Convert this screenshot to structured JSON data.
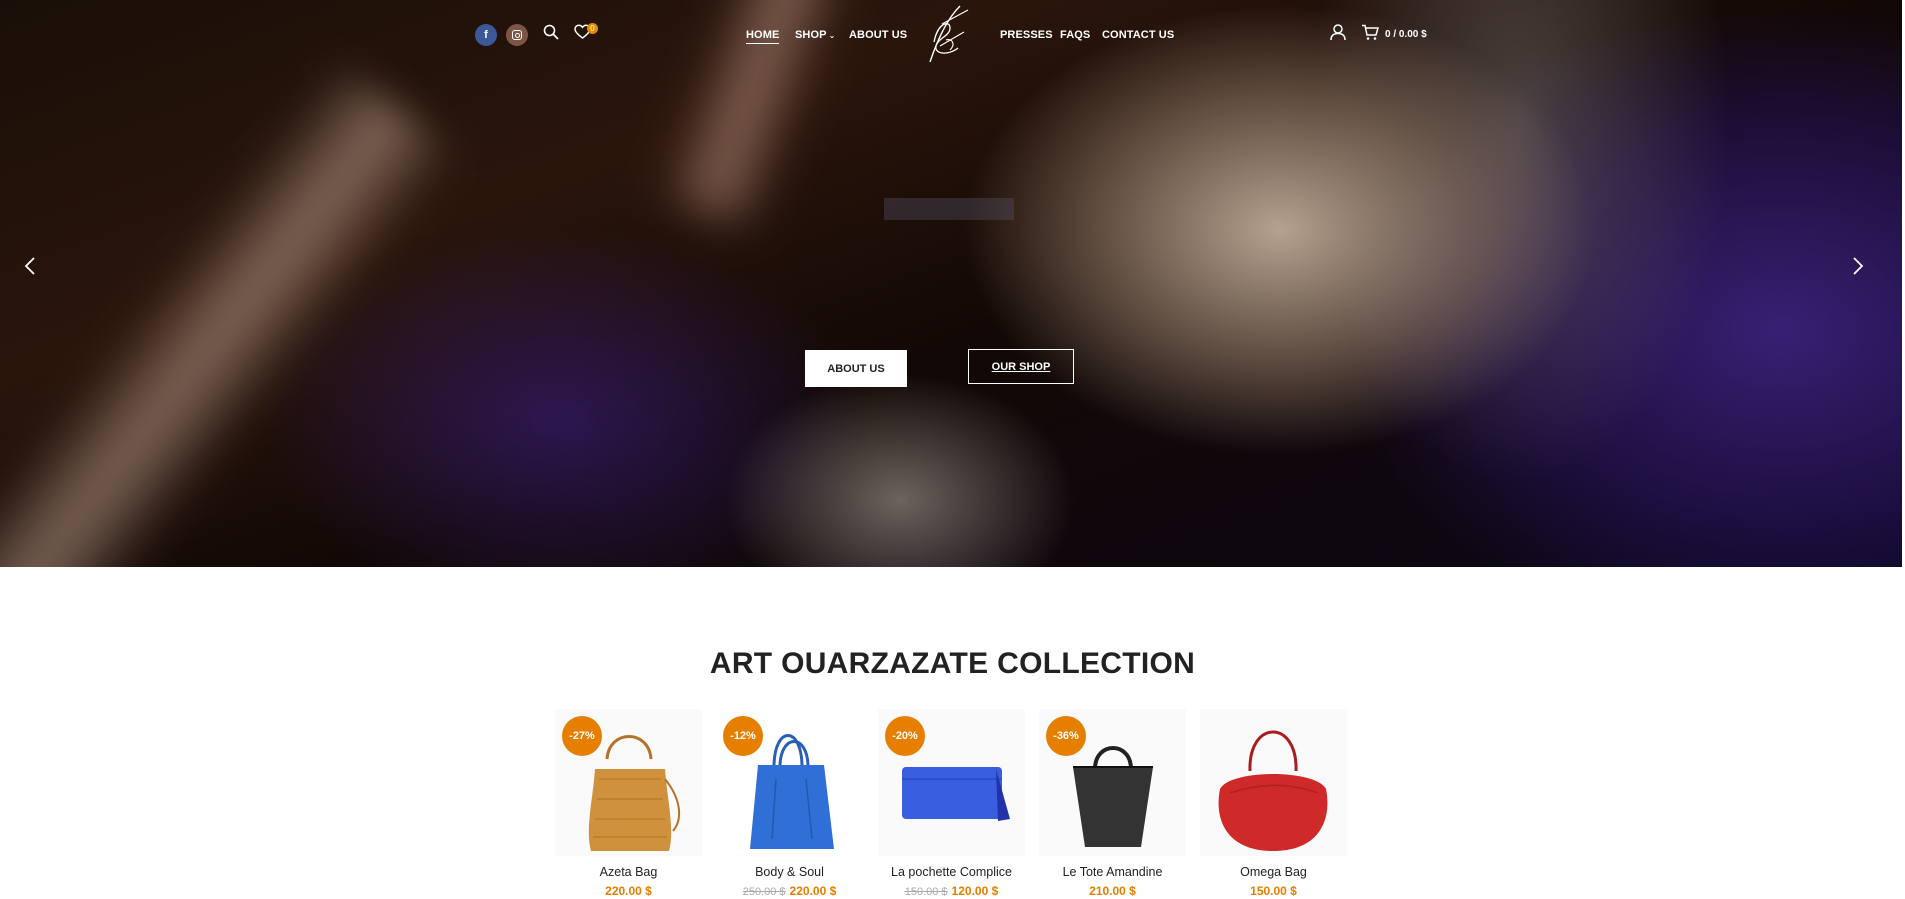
{
  "header": {
    "wishlist_count": "0",
    "nav": {
      "home": "HOME",
      "shop": "SHOP",
      "about": "ABOUT US",
      "presses": "PRESSES",
      "faqs": "FAQS",
      "contact": "CONTACT US"
    },
    "cart_total": "0 / 0.00 $",
    "icons": [
      "facebook-icon",
      "instagram-icon",
      "search-icon",
      "heart-icon",
      "user-icon",
      "cart-icon"
    ]
  },
  "hero": {
    "about_button": "ABOUT US",
    "shop_button": "OUR SHOP"
  },
  "collection": {
    "title": "ART OUARZAZATE COLLECTION",
    "products": [
      {
        "name": "Azeta Bag",
        "discount": "-27%",
        "old_price": "",
        "price": "220.00 $",
        "color": "#d0913c"
      },
      {
        "name": "Body & Soul",
        "discount": "-12%",
        "old_price": "250.00 $",
        "price": "220.00 $",
        "color": "#2f6fd6"
      },
      {
        "name": "La pochette Complice",
        "discount": "-20%",
        "old_price": "150.00 $",
        "price": "120.00 $",
        "color": "#3a5ee0"
      },
      {
        "name": "Le Tote Amandine",
        "discount": "-36%",
        "old_price": "",
        "price": "210.00 $",
        "color": "#333333"
      },
      {
        "name": "Omega Bag",
        "discount": "",
        "old_price": "",
        "price": "150.00 $",
        "color": "#cf2a2a"
      }
    ]
  },
  "colors": {
    "accent": "#e67e00",
    "facebook": "#3b5998",
    "instagram": "#7d5546"
  }
}
